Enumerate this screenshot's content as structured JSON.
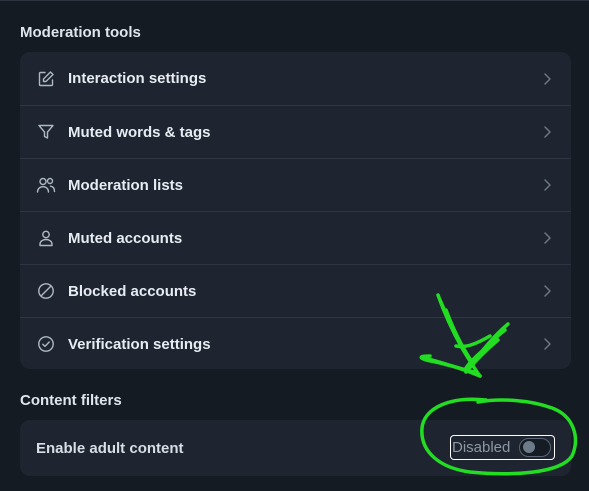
{
  "moderation": {
    "title": "Moderation tools",
    "items": [
      {
        "label": "Interaction settings",
        "icon": "edit-icon"
      },
      {
        "label": "Muted words & tags",
        "icon": "filter-icon"
      },
      {
        "label": "Moderation lists",
        "icon": "users-icon"
      },
      {
        "label": "Muted accounts",
        "icon": "person-icon"
      },
      {
        "label": "Blocked accounts",
        "icon": "block-icon"
      },
      {
        "label": "Verification settings",
        "icon": "check-circle-icon"
      }
    ]
  },
  "content_filters": {
    "title": "Content filters",
    "adult_content_label": "Enable adult content",
    "toggle_state_label": "Disabled",
    "toggle_on": false
  },
  "colors": {
    "background": "#151b23",
    "panel": "#1e2530",
    "annotation": "#22dd22"
  }
}
